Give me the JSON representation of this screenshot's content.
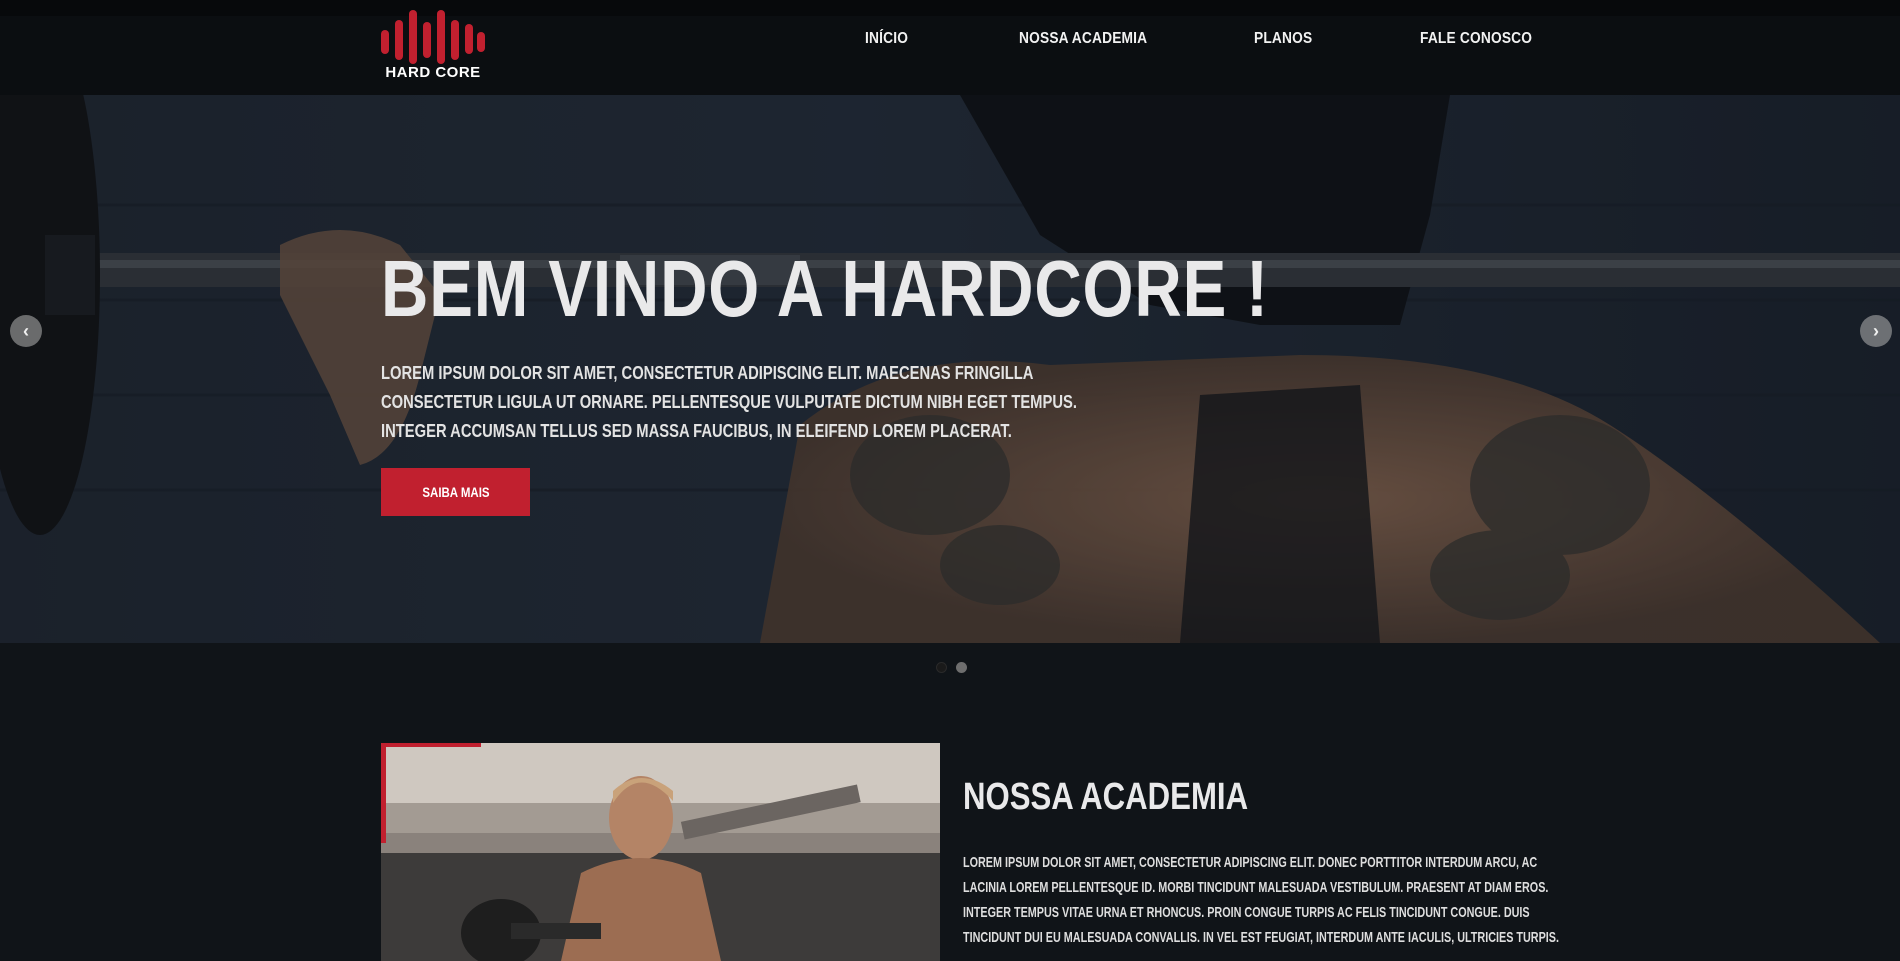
{
  "brand": {
    "logo_text": "HARD CORE",
    "accent": "#c1202f"
  },
  "nav": {
    "items": [
      {
        "label": "INÍCIO"
      },
      {
        "label": "NOSSA ACADEMIA"
      },
      {
        "label": "PLANOS"
      },
      {
        "label": "FALE CONOSCO"
      }
    ]
  },
  "hero": {
    "title": "BEM VINDO A HARDCORE !",
    "lines": [
      "LOREM IPSUM DOLOR SIT AMET, CONSECTETUR ADIPISCING ELIT. MAECENAS FRINGILLA",
      "CONSECTETUR LIGULA UT ORNARE. PELLENTESQUE VULPUTATE DICTUM NIBH EGET TEMPUS.",
      "INTEGER ACCUMSAN TELLUS SED MASSA FAUCIBUS, IN ELEIFEND LOREM PLACERAT."
    ],
    "button_label": "SAIBA MAIS",
    "prev_icon": "chevron-left-icon",
    "next_icon": "chevron-right-icon",
    "slide_count": 2,
    "active_slide": 1
  },
  "about": {
    "title": "NOSSA ACADEMIA",
    "lines": [
      "LOREM IPSUM DOLOR SIT AMET, CONSECTETUR ADIPISCING ELIT. DONEC PORTTITOR INTERDUM ARCU, AC",
      "LACINIA LOREM PELLENTESQUE ID. MORBI TINCIDUNT MALESUADA VESTIBULUM. PRAESENT AT DIAM EROS.",
      "INTEGER TEMPUS VITAE URNA ET RHONCUS. PROIN CONGUE TURPIS AC FELIS TINCIDUNT CONGUE. DUIS",
      "TINCIDUNT DUI EU MALESUADA CONVALLIS. IN VEL EST FEUGIAT, INTERDUM ANTE IACULIS, ULTRICIES TURPIS."
    ]
  }
}
